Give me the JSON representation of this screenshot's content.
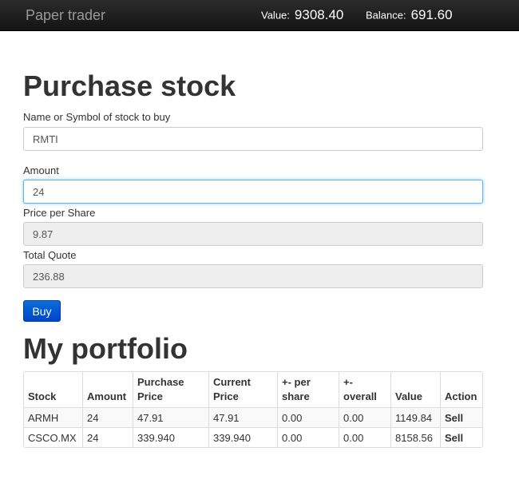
{
  "navbar": {
    "brand": "Paper trader",
    "value_label": "Value:",
    "value": "9308.40",
    "balance_label": "Balance:",
    "balance": "691.60"
  },
  "purchase": {
    "title": "Purchase stock",
    "symbol_label": "Name or Symbol of stock to buy",
    "symbol_value": "RMTI",
    "amount_label": "Amount",
    "amount_value": "24",
    "price_label": "Price per Share",
    "price_value": "9.87",
    "total_label": "Total Quote",
    "total_value": "236.88",
    "buy_label": "Buy"
  },
  "portfolio": {
    "title": "My portfolio",
    "headers": {
      "stock": "Stock",
      "amount": "Amount",
      "purchase_price": "Purchase Price",
      "current_price": "Current Price",
      "per_share": "+- per share",
      "overall": "+- overall",
      "value": "Value",
      "action": "Action"
    },
    "rows": [
      {
        "stock": "ARMH",
        "amount": "24",
        "purchase_price": "47.91",
        "current_price": "47.91",
        "per_share": "0.00",
        "overall": "0.00",
        "value": "1149.84",
        "action": "Sell"
      },
      {
        "stock": "CSCO.MX",
        "amount": "24",
        "purchase_price": "339.940",
        "current_price": "339.940",
        "per_share": "0.00",
        "overall": "0.00",
        "value": "8158.56",
        "action": "Sell"
      }
    ]
  }
}
